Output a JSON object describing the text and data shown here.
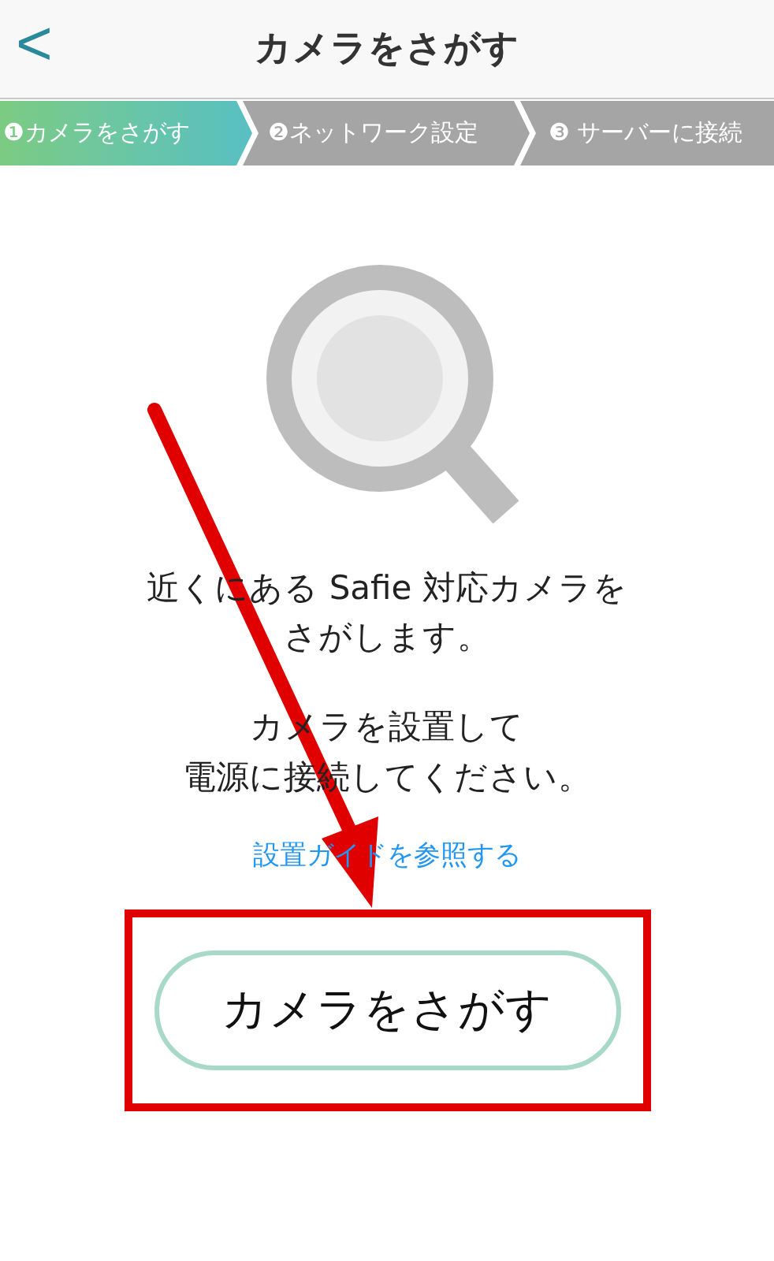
{
  "header": {
    "back": "<",
    "title": "カメラをさがす"
  },
  "steps": [
    {
      "label": "❶カメラをさがす",
      "selected": true
    },
    {
      "label": "❷ネットワーク設定",
      "selected": false
    },
    {
      "label": "❸ サーバーに接続",
      "selected": false
    }
  ],
  "message": [
    "近くにある Safie 対応カメラを",
    "さがします。"
  ],
  "instruction": [
    "カメラを設置して",
    "電源に接続してください。"
  ],
  "guide_link": "設置ガイドを参照する",
  "search_button": "カメラをさがす"
}
